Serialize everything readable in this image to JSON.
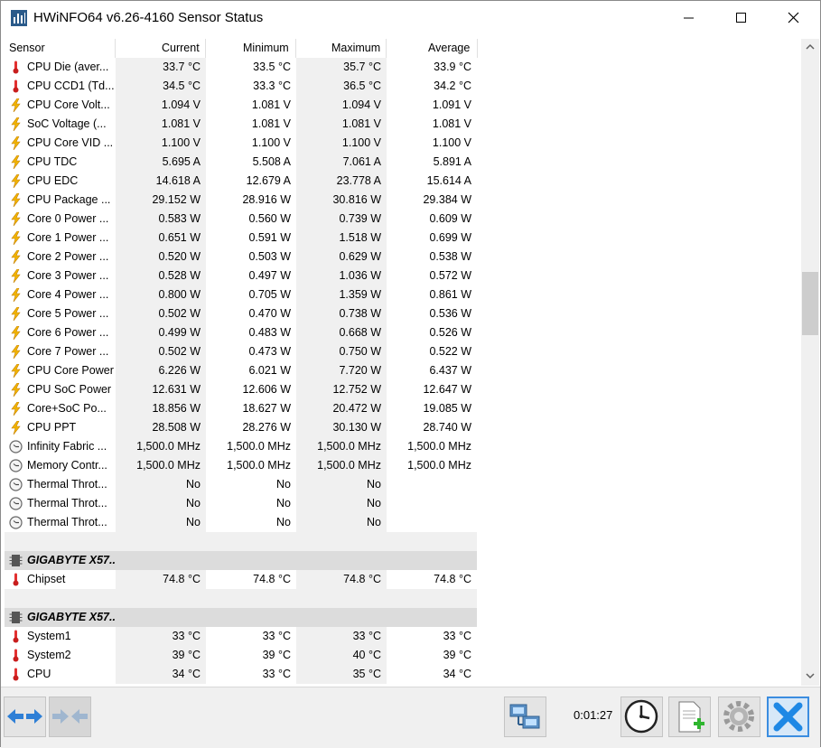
{
  "window": {
    "title": "HWiNFO64 v6.26-4160 Sensor Status"
  },
  "columns": [
    "Sensor",
    "Current",
    "Minimum",
    "Maximum",
    "Average"
  ],
  "rows": [
    {
      "type": "data",
      "icon": "thermometer-icon",
      "name": "CPU Die (aver...",
      "current": "33.7 °C",
      "minimum": "33.5 °C",
      "maximum": "35.7 °C",
      "average": "33.9 °C"
    },
    {
      "type": "data",
      "icon": "thermometer-icon",
      "name": "CPU CCD1 (Td...",
      "current": "34.5 °C",
      "minimum": "33.3 °C",
      "maximum": "36.5 °C",
      "average": "34.2 °C"
    },
    {
      "type": "data",
      "icon": "lightning-icon",
      "name": "CPU Core Volt...",
      "current": "1.094 V",
      "minimum": "1.081 V",
      "maximum": "1.094 V",
      "average": "1.091 V"
    },
    {
      "type": "data",
      "icon": "lightning-icon",
      "name": "SoC Voltage (...",
      "current": "1.081 V",
      "minimum": "1.081 V",
      "maximum": "1.081 V",
      "average": "1.081 V"
    },
    {
      "type": "data",
      "icon": "lightning-icon",
      "name": "CPU Core VID ...",
      "current": "1.100 V",
      "minimum": "1.100 V",
      "maximum": "1.100 V",
      "average": "1.100 V"
    },
    {
      "type": "data",
      "icon": "lightning-icon",
      "name": "CPU TDC",
      "current": "5.695 A",
      "minimum": "5.508 A",
      "maximum": "7.061 A",
      "average": "5.891 A"
    },
    {
      "type": "data",
      "icon": "lightning-icon",
      "name": "CPU EDC",
      "current": "14.618 A",
      "minimum": "12.679 A",
      "maximum": "23.778 A",
      "average": "15.614 A"
    },
    {
      "type": "data",
      "icon": "lightning-icon",
      "name": "CPU Package ...",
      "current": "29.152 W",
      "minimum": "28.916 W",
      "maximum": "30.816 W",
      "average": "29.384 W"
    },
    {
      "type": "data",
      "icon": "lightning-icon",
      "name": "Core 0 Power ...",
      "current": "0.583 W",
      "minimum": "0.560 W",
      "maximum": "0.739 W",
      "average": "0.609 W"
    },
    {
      "type": "data",
      "icon": "lightning-icon",
      "name": "Core 1 Power ...",
      "current": "0.651 W",
      "minimum": "0.591 W",
      "maximum": "1.518 W",
      "average": "0.699 W"
    },
    {
      "type": "data",
      "icon": "lightning-icon",
      "name": "Core 2 Power ...",
      "current": "0.520 W",
      "minimum": "0.503 W",
      "maximum": "0.629 W",
      "average": "0.538 W"
    },
    {
      "type": "data",
      "icon": "lightning-icon",
      "name": "Core 3 Power ...",
      "current": "0.528 W",
      "minimum": "0.497 W",
      "maximum": "1.036 W",
      "average": "0.572 W"
    },
    {
      "type": "data",
      "icon": "lightning-icon",
      "name": "Core 4 Power ...",
      "current": "0.800 W",
      "minimum": "0.705 W",
      "maximum": "1.359 W",
      "average": "0.861 W"
    },
    {
      "type": "data",
      "icon": "lightning-icon",
      "name": "Core 5 Power ...",
      "current": "0.502 W",
      "minimum": "0.470 W",
      "maximum": "0.738 W",
      "average": "0.536 W"
    },
    {
      "type": "data",
      "icon": "lightning-icon",
      "name": "Core 6 Power ...",
      "current": "0.499 W",
      "minimum": "0.483 W",
      "maximum": "0.668 W",
      "average": "0.526 W"
    },
    {
      "type": "data",
      "icon": "lightning-icon",
      "name": "Core 7 Power ...",
      "current": "0.502 W",
      "minimum": "0.473 W",
      "maximum": "0.750 W",
      "average": "0.522 W"
    },
    {
      "type": "data",
      "icon": "lightning-icon",
      "name": "CPU Core Power",
      "current": "6.226 W",
      "minimum": "6.021 W",
      "maximum": "7.720 W",
      "average": "6.437 W"
    },
    {
      "type": "data",
      "icon": "lightning-icon",
      "name": "CPU SoC Power",
      "current": "12.631 W",
      "minimum": "12.606 W",
      "maximum": "12.752 W",
      "average": "12.647 W"
    },
    {
      "type": "data",
      "icon": "lightning-icon",
      "name": "Core+SoC Po...",
      "current": "18.856 W",
      "minimum": "18.627 W",
      "maximum": "20.472 W",
      "average": "19.085 W"
    },
    {
      "type": "data",
      "icon": "lightning-icon",
      "name": "CPU PPT",
      "current": "28.508 W",
      "minimum": "28.276 W",
      "maximum": "30.130 W",
      "average": "28.740 W"
    },
    {
      "type": "data",
      "icon": "clock-icon",
      "name": "Infinity Fabric ...",
      "current": "1,500.0 MHz",
      "minimum": "1,500.0 MHz",
      "maximum": "1,500.0 MHz",
      "average": "1,500.0 MHz"
    },
    {
      "type": "data",
      "icon": "clock-icon",
      "name": "Memory Contr...",
      "current": "1,500.0 MHz",
      "minimum": "1,500.0 MHz",
      "maximum": "1,500.0 MHz",
      "average": "1,500.0 MHz"
    },
    {
      "type": "data",
      "icon": "clock-icon",
      "name": "Thermal Throt...",
      "current": "No",
      "minimum": "No",
      "maximum": "No",
      "average": ""
    },
    {
      "type": "data",
      "icon": "clock-icon",
      "name": "Thermal Throt...",
      "current": "No",
      "minimum": "No",
      "maximum": "No",
      "average": ""
    },
    {
      "type": "data",
      "icon": "clock-icon",
      "name": "Thermal Throt...",
      "current": "No",
      "minimum": "No",
      "maximum": "No",
      "average": ""
    },
    {
      "type": "empty"
    },
    {
      "type": "group",
      "icon": "chip-icon",
      "name": "GIGABYTE X57..."
    },
    {
      "type": "data",
      "icon": "thermometer-icon",
      "name": "Chipset",
      "current": "74.8 °C",
      "minimum": "74.8 °C",
      "maximum": "74.8 °C",
      "average": "74.8 °C"
    },
    {
      "type": "empty"
    },
    {
      "type": "group",
      "icon": "chip-icon",
      "name": "GIGABYTE X57..."
    },
    {
      "type": "data",
      "icon": "thermometer-icon",
      "name": "System1",
      "current": "33 °C",
      "minimum": "33 °C",
      "maximum": "33 °C",
      "average": "33 °C"
    },
    {
      "type": "data",
      "icon": "thermometer-icon",
      "name": "System2",
      "current": "39 °C",
      "minimum": "39 °C",
      "maximum": "40 °C",
      "average": "39 °C"
    },
    {
      "type": "data",
      "icon": "thermometer-icon",
      "name": "CPU",
      "current": "34 °C",
      "minimum": "33 °C",
      "maximum": "35 °C",
      "average": "34 °C"
    }
  ],
  "statusbar": {
    "elapsed": "0:01:27"
  },
  "colors": {
    "row_alt": "#f0f0f0",
    "group_bg": "#dcdcdc",
    "close_accent": "#1e88e5"
  }
}
